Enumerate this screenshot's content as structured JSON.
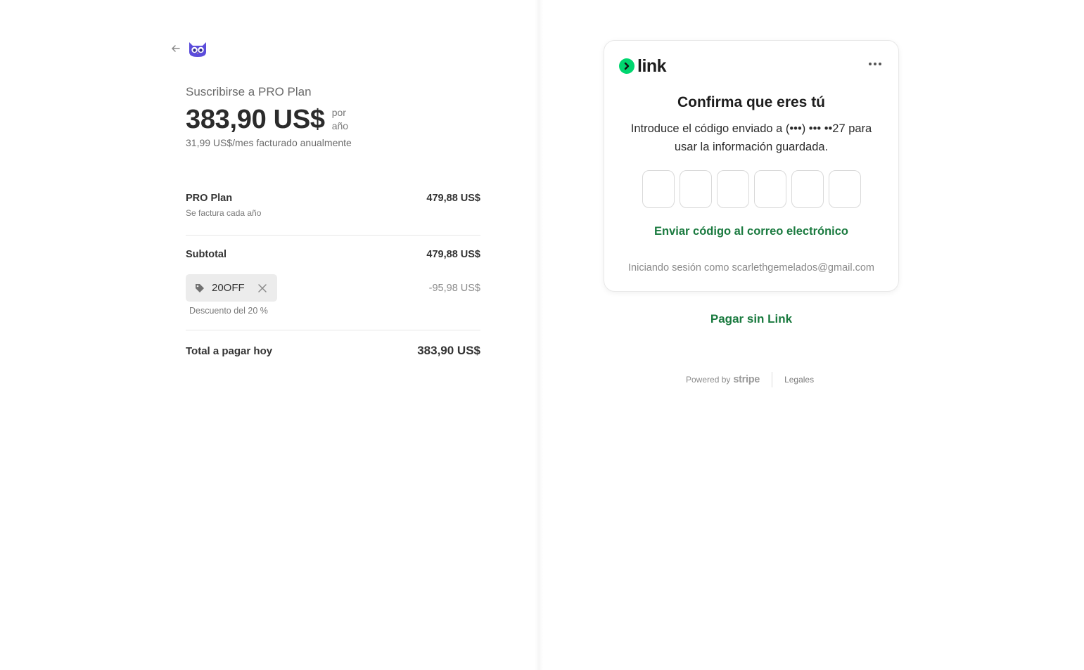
{
  "summary": {
    "subscribe_title": "Suscribirse a PRO Plan",
    "price": "383,90 US$",
    "per_line1": "por",
    "per_line2": "año",
    "monthly_note": "31,99 US$/mes facturado anualmente",
    "plan_name": "PRO Plan",
    "plan_billing": "Se factura cada año",
    "plan_amount": "479,88 US$",
    "subtotal_label": "Subtotal",
    "subtotal_amount": "479,88 US$",
    "promo_code": "20OFF",
    "discount_amount": "-95,98 US$",
    "discount_label": "Descuento del 20 %",
    "total_label": "Total a pagar hoy",
    "total_amount": "383,90 US$"
  },
  "link_card": {
    "logo_text": "link",
    "title": "Confirma que eres tú",
    "description": "Introduce el código enviado a (•••) ••• ••27 para usar la información guardada.",
    "otp_digits": [
      "",
      "",
      "",
      "",
      "",
      ""
    ],
    "send_email_code": "Enviar código al correo electrónico",
    "signed_in_as": "Iniciando sesión como scarlethgemelados@gmail.com"
  },
  "pay_without_link": "Pagar sin Link",
  "footer": {
    "powered_by": "Powered by",
    "stripe": "stripe",
    "legal": "Legales"
  },
  "colors": {
    "link_green": "#00d66f",
    "action_green": "#1a7a3f",
    "brand_purple": "#5b4cdb"
  },
  "icons": {
    "back": "arrow-left-icon",
    "brand": "owl-logo-icon",
    "promo_tag": "tag-icon",
    "promo_remove": "close-icon",
    "more": "more-horizontal-icon",
    "link_badge": "chevron-right-icon"
  }
}
